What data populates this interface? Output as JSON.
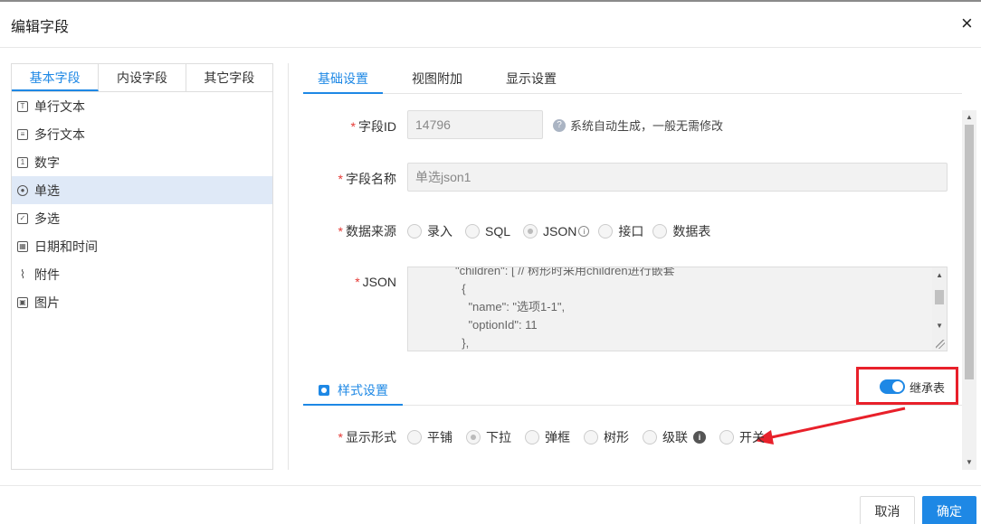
{
  "dialog": {
    "title": "编辑字段",
    "close_icon": "×"
  },
  "left_tabs": [
    "基本字段",
    "内设字段",
    "其它字段"
  ],
  "field_types": [
    {
      "label": "单行文本",
      "icon": "text-icon"
    },
    {
      "label": "多行文本",
      "icon": "multiline-text-icon"
    },
    {
      "label": "数字",
      "icon": "number-icon"
    },
    {
      "label": "单选",
      "icon": "radio-icon",
      "active": true
    },
    {
      "label": "多选",
      "icon": "checkbox-icon"
    },
    {
      "label": "日期和时间",
      "icon": "calendar-icon"
    },
    {
      "label": "附件",
      "icon": "paperclip-icon"
    },
    {
      "label": "图片",
      "icon": "image-icon"
    }
  ],
  "right_tabs": [
    "基础设置",
    "视图附加",
    "显示设置"
  ],
  "form": {
    "field_id": {
      "label": "字段ID",
      "value": "14796",
      "help": "系统自动生成，一般无需修改"
    },
    "field_name": {
      "label": "字段名称",
      "value": "单选json1"
    },
    "data_source": {
      "label": "数据来源",
      "options": [
        "录入",
        "SQL",
        "JSON",
        "接口",
        "数据表"
      ],
      "selected": "JSON"
    },
    "json": {
      "label": "JSON",
      "lines": [
        "\"children\": [ // 树形时采用children进行嵌套",
        "  {",
        "    \"name\": \"选项1-1\",",
        "    \"optionId\": 11",
        "  },"
      ]
    }
  },
  "style_section": {
    "title": "样式设置",
    "inherit_label": "继承表",
    "inherit_on": true
  },
  "display_mode": {
    "label": "显示形式",
    "options": [
      "平铺",
      "下拉",
      "弹框",
      "树形",
      "级联",
      "开关"
    ],
    "selected": "下拉"
  },
  "footer": {
    "cancel_label": "取消",
    "ok_label": "确定"
  },
  "colors": {
    "accent": "#1e88e5",
    "annotation": "#e8202a",
    "required": "#e53935"
  }
}
